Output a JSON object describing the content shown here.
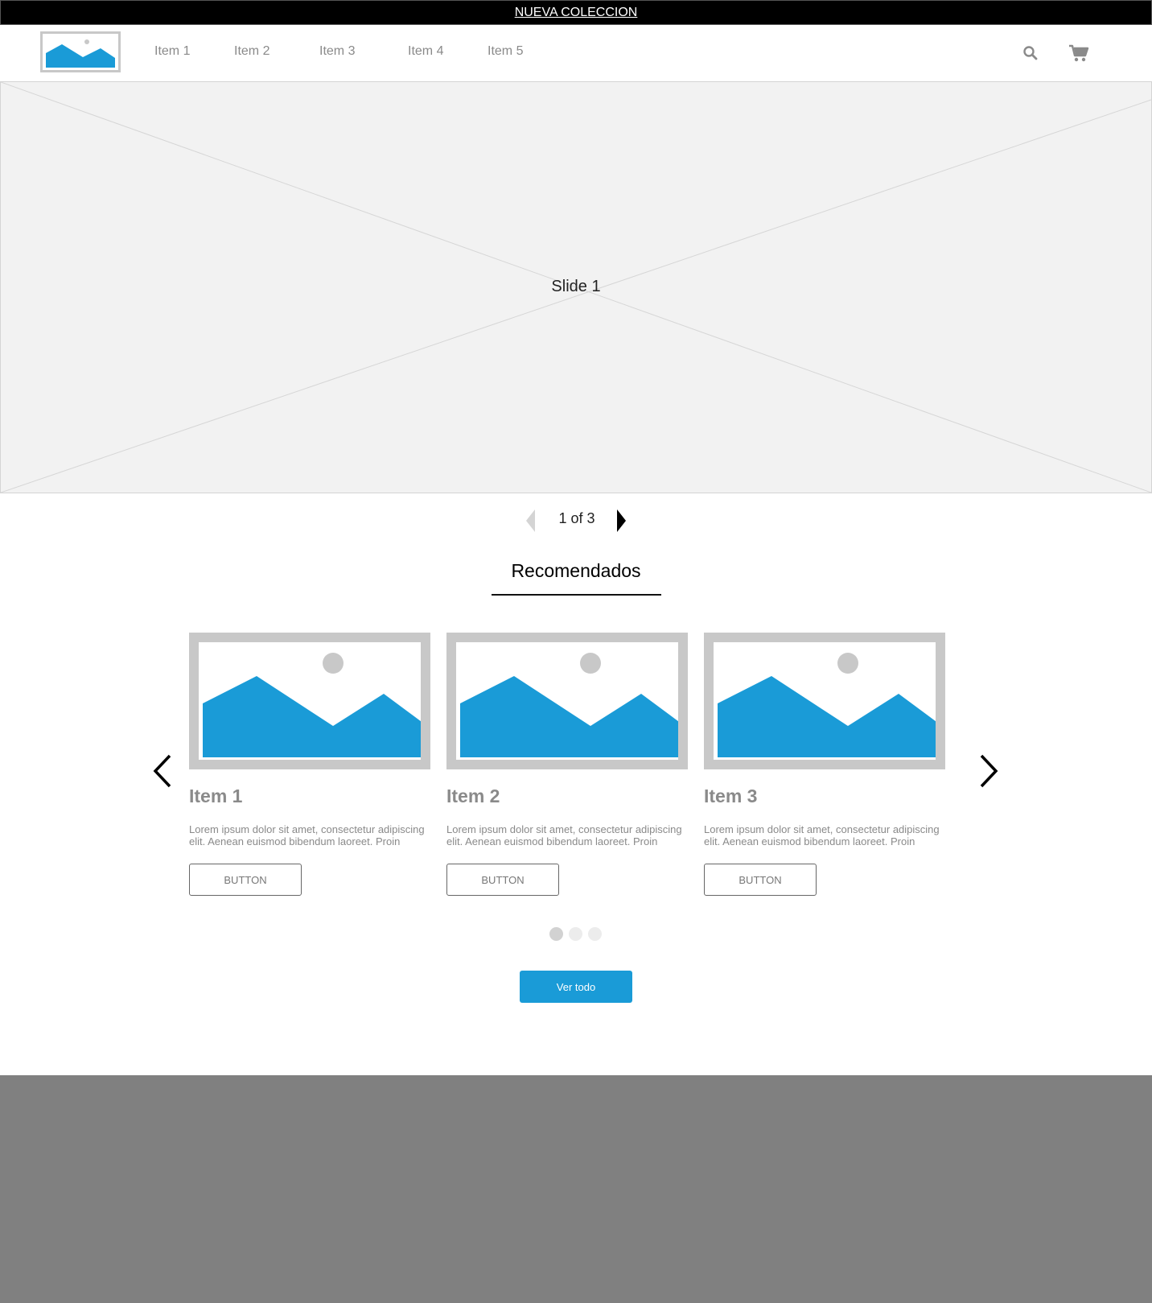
{
  "banner": {
    "link_text": "NUEVA COLECCION"
  },
  "header": {
    "logo_icon": "image-placeholder-icon",
    "nav_items": [
      "Item 1",
      "Item 2",
      "Item 3",
      "Item 4",
      "Item 5"
    ],
    "search_icon": "search-icon",
    "cart_icon": "cart-icon"
  },
  "hero": {
    "slide_label": "Slide 1"
  },
  "pager": {
    "text": "1 of 3",
    "prev_icon": "caret-left-icon",
    "next_icon": "caret-right-icon"
  },
  "recommended": {
    "title": "Recomendados",
    "prev_icon": "chevron-left-icon",
    "next_icon": "chevron-right-icon",
    "cards": [
      {
        "title": "Item 1",
        "text": "Lorem ipsum dolor sit amet, consectetur adipiscing elit. Aenean euismod bibendum laoreet. Proin",
        "button": "BUTTON"
      },
      {
        "title": "Item 2",
        "text": "Lorem ipsum dolor sit amet, consectetur adipiscing elit. Aenean euismod bibendum laoreet. Proin",
        "button": "BUTTON"
      },
      {
        "title": "Item 3",
        "text": "Lorem ipsum dolor sit amet, consectetur adipiscing elit. Aenean euismod bibendum laoreet. Proin",
        "button": "BUTTON"
      }
    ],
    "dots_count": 3,
    "active_dot": 1,
    "view_all_label": "Ver todo"
  },
  "colors": {
    "accent": "#1a9bd7",
    "banner_bg": "#000000",
    "footer_bg": "#808080",
    "placeholder_gray": "#c8c8c8"
  }
}
